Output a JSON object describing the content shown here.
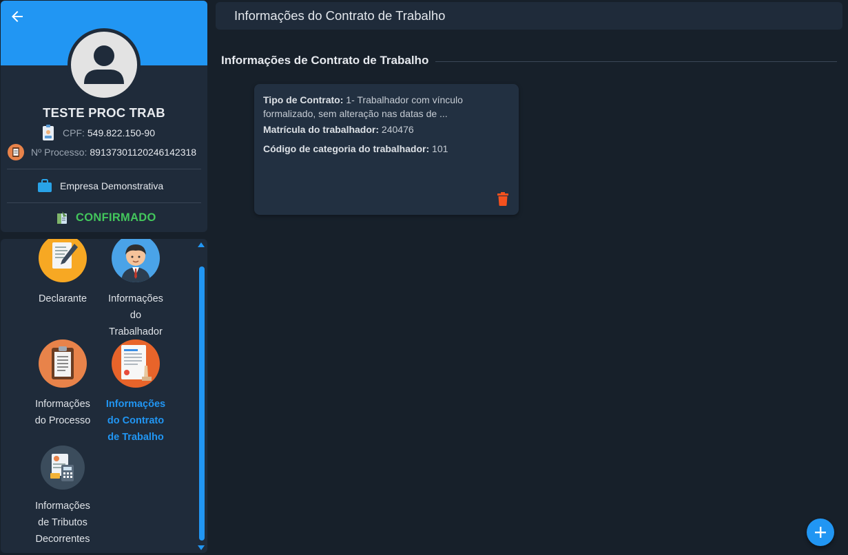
{
  "profile": {
    "name": "TESTE PROC TRAB",
    "cpf_label": "CPF:",
    "cpf_value": "549.822.150-90",
    "process_label": "Nº Processo:",
    "process_value": "89137301120246142318",
    "company": "Empresa Demonstrativa",
    "status": "CONFIRMADO",
    "colors": {
      "banner": "#2196f3",
      "status": "#43c65c"
    }
  },
  "nav": {
    "items": [
      {
        "label": "Declarante",
        "icon": "declarant-icon",
        "active": false
      },
      {
        "label": "Informações\ndo\nTrabalhador",
        "icon": "worker-icon",
        "active": false
      },
      {
        "label": "Informações\ndo Processo",
        "icon": "process-clipboard-icon",
        "active": false
      },
      {
        "label": "Informações\ndo Contrato\nde Trabalho",
        "icon": "contract-document-icon",
        "active": true
      },
      {
        "label": "Informações\nde Tributos\nDecorrentes",
        "icon": "tax-calculator-icon",
        "active": false
      }
    ]
  },
  "header": {
    "title": "Informações do Contrato de Trabalho"
  },
  "section": {
    "title": "Informações de Contrato de Trabalho"
  },
  "contract_card": {
    "type_label": "Tipo de Contrato:",
    "type_value": "1- Trabalhador com vínculo formalizado, sem alteração nas datas de ...",
    "registration_label": "Matrícula do trabalhador:",
    "registration_value": "240476",
    "category_label": "Código de categoria do trabalhador:",
    "category_value": "101"
  },
  "actions": {
    "add_icon": "plus-icon",
    "delete_icon": "trash-icon",
    "accent": "#2196f3",
    "danger": "#f4511e"
  }
}
